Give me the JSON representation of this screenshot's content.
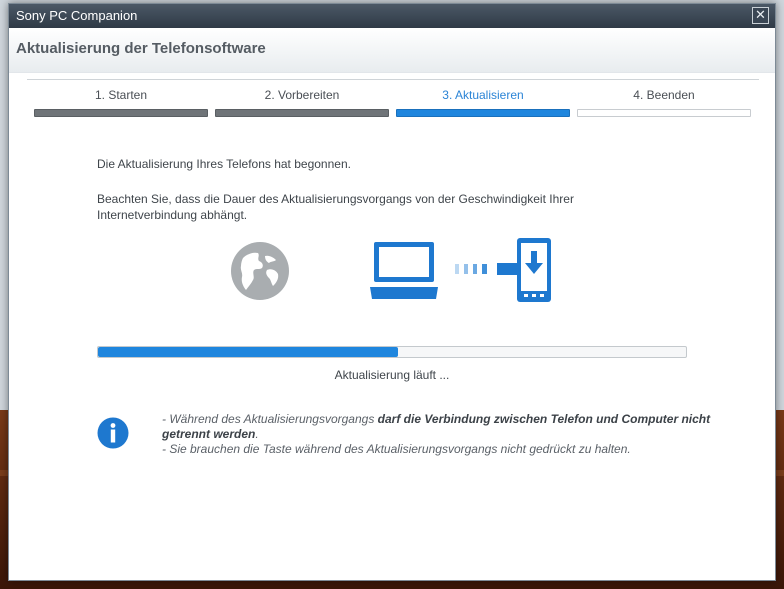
{
  "window": {
    "title": "Sony PC Companion",
    "close_glyph": "✕"
  },
  "page_title": "Aktualisierung der Telefonsoftware",
  "steps": [
    {
      "label": "1. Starten",
      "state": "done"
    },
    {
      "label": "2. Vorbereiten",
      "state": "done"
    },
    {
      "label": "3. Aktualisieren",
      "state": "current"
    },
    {
      "label": "4. Beenden",
      "state": "todo"
    }
  ],
  "messages": {
    "line1": "Die Aktualisierung Ihres Telefons hat begonnen.",
    "line2a": "Beachten Sie, dass die Dauer des Aktualisierungsvorgangs von der Geschwindigkeit Ihrer",
    "line2b": "Internetverbindung abhängt."
  },
  "illustration": {
    "icons": [
      "globe-icon",
      "laptop-icon",
      "transfer-dots-icon",
      "phone-download-icon"
    ]
  },
  "progress": {
    "fraction": 0.51,
    "label": "Aktualisierung läuft ..."
  },
  "notes": {
    "n1_pre": "- Während des Aktualisierungsvorgangs ",
    "n1_bold": "darf die Verbindung zwischen Telefon und Computer nicht getrennt werden",
    "n1_post": ".",
    "n2": "- Sie brauchen die Taste während des Aktualisierungsvorgangs nicht gedrückt zu halten."
  },
  "colors": {
    "accent": "#1f86de",
    "icon_gray": "#a9adb0",
    "title_text": "#555c63"
  }
}
